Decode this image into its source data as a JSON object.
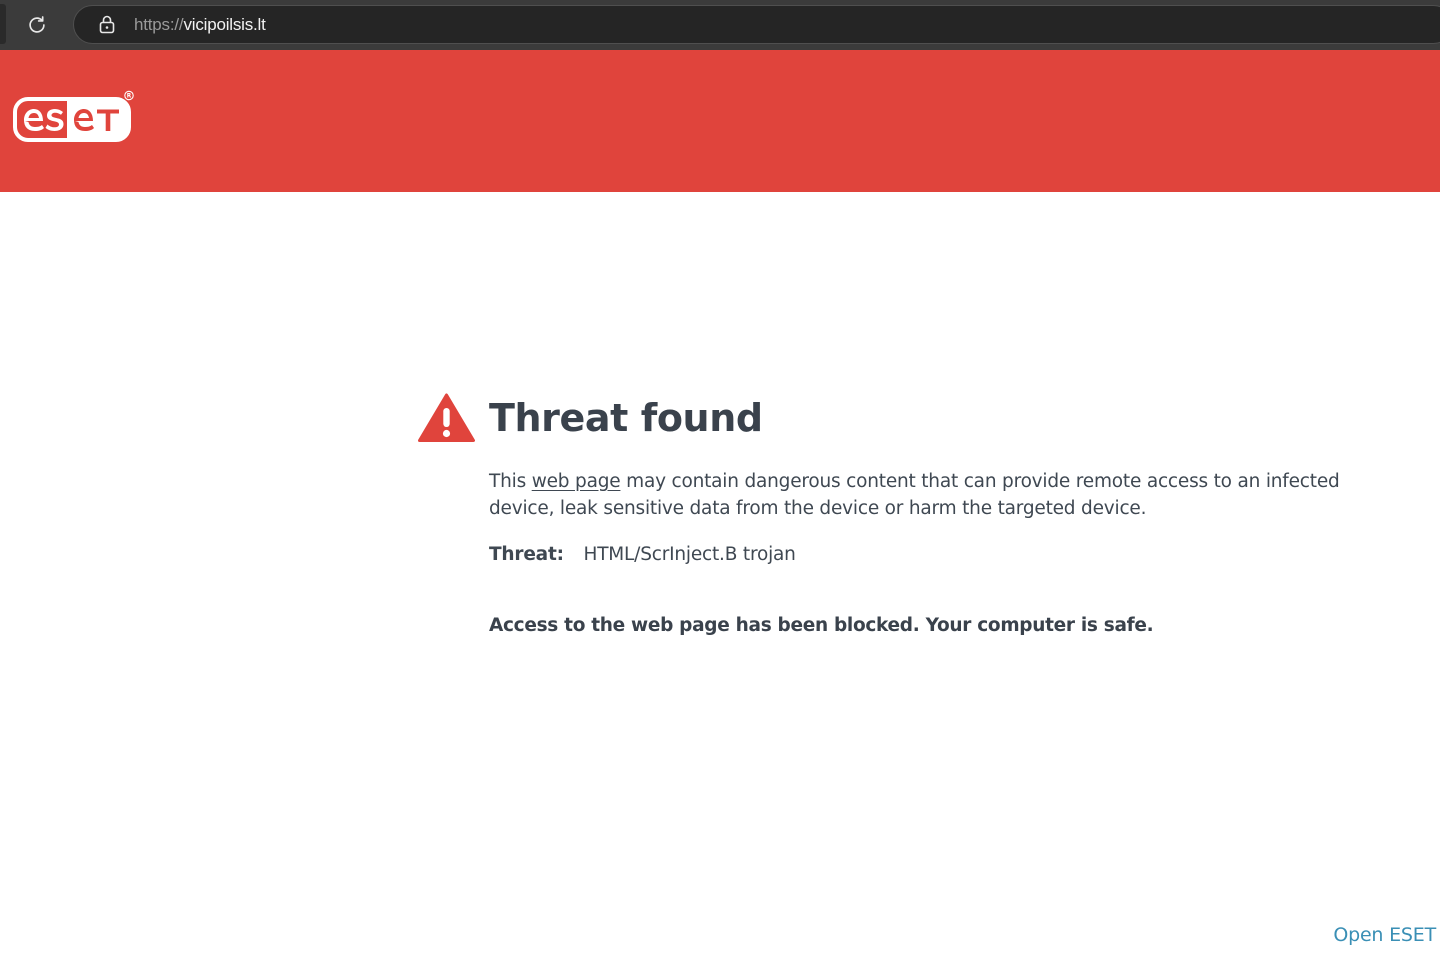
{
  "browser": {
    "url_protocol": "https://",
    "url_host": "vicipoilsis.lt"
  },
  "header": {
    "brand_color": "#e0443c",
    "logo": "eset-logo"
  },
  "content": {
    "title": "Threat found",
    "desc_part1": "This ",
    "desc_link": "web page",
    "desc_part2": " may contain dangerous content that can provide remote access to an infected device, leak sensitive data from the device or harm the targeted device.",
    "threat_label": "Threat:",
    "threat_value": "HTML/ScrInject.B trojan",
    "blocked_message": "Access to the web page has been blocked. Your computer is safe."
  },
  "footer": {
    "open_eset": "Open ESET",
    "link_color": "#3a8fb5"
  }
}
